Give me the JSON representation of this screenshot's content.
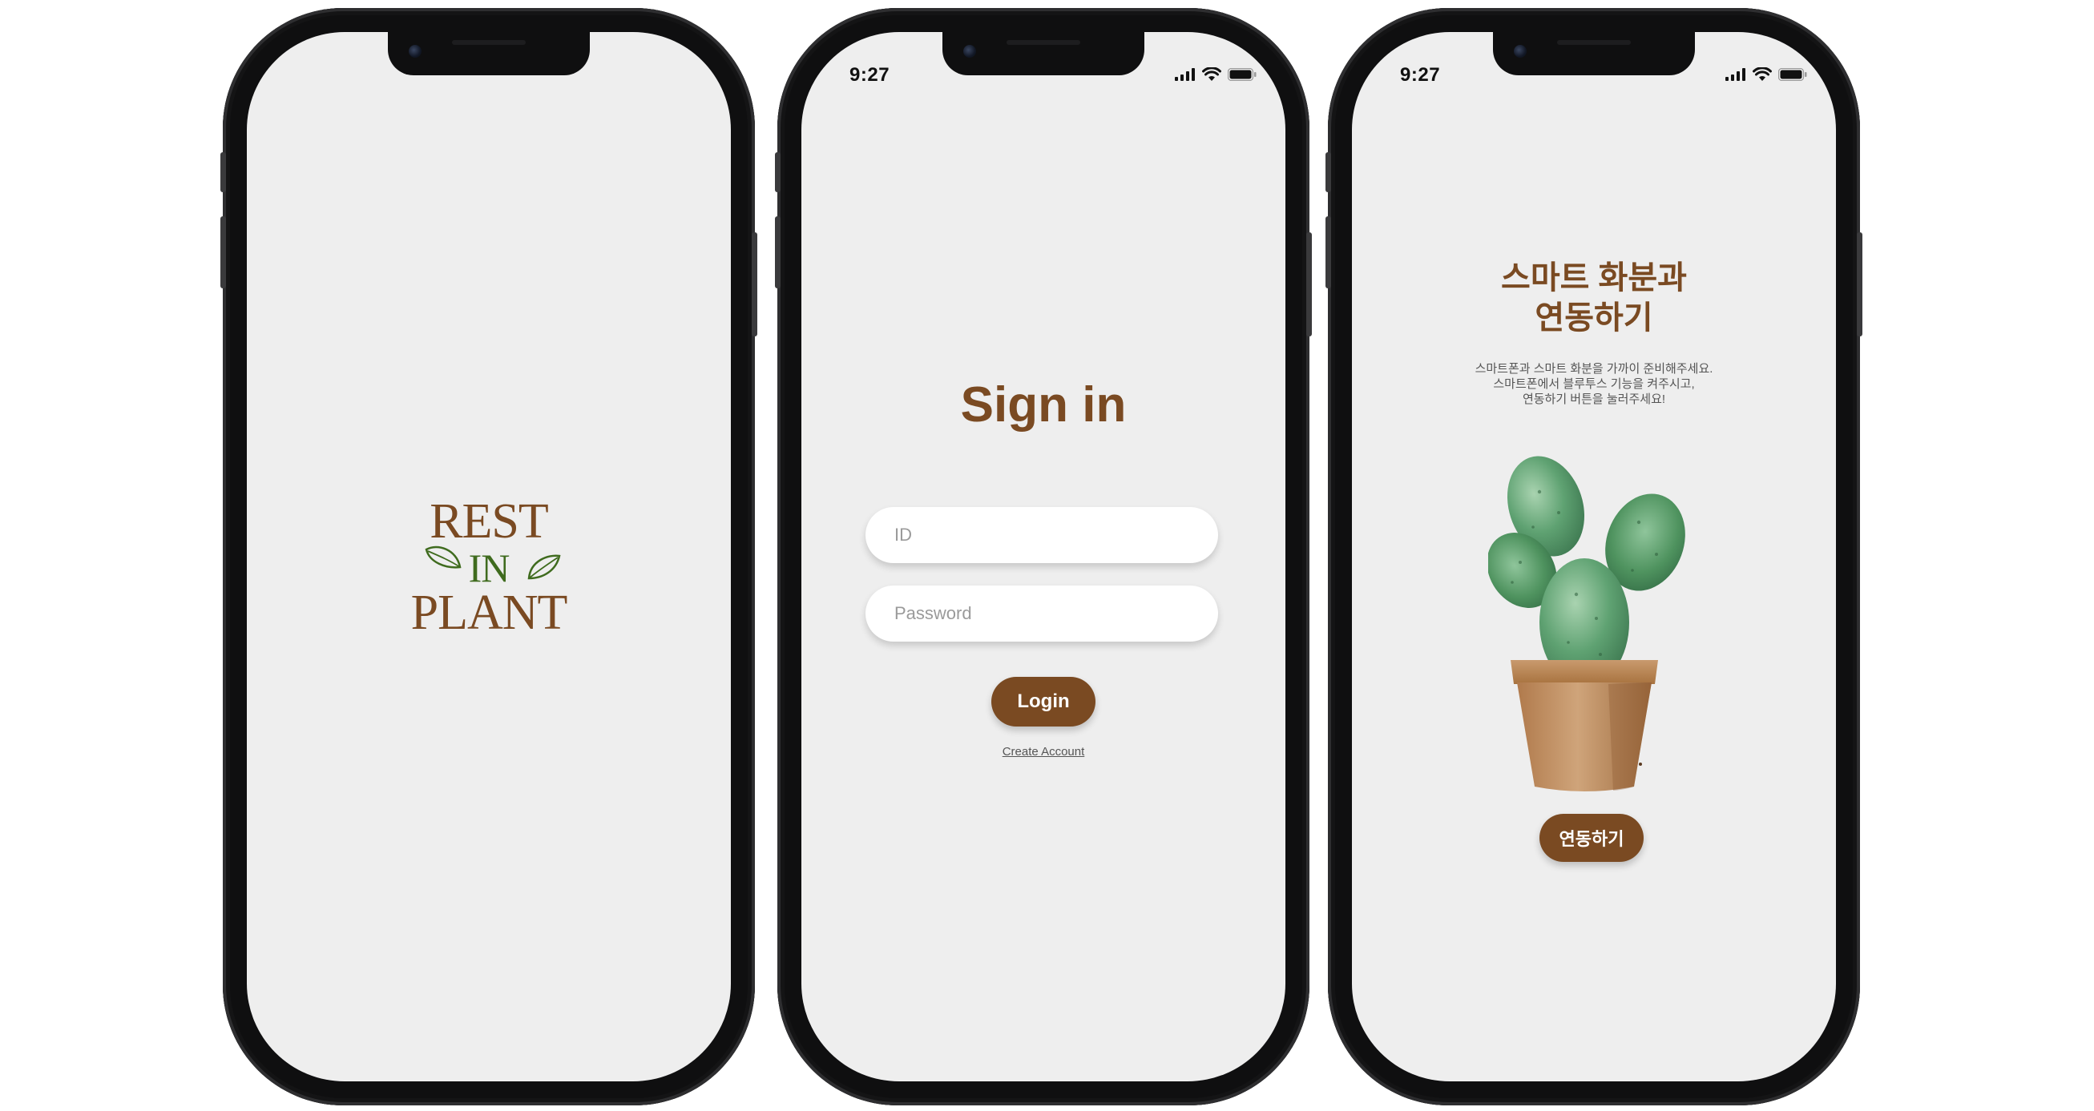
{
  "status_bar": {
    "time": "9:27"
  },
  "splash": {
    "logo_rest": "REST",
    "logo_in": "IN",
    "logo_plant": "PLANT"
  },
  "signin": {
    "title": "Sign in",
    "id_placeholder": "ID",
    "password_placeholder": "Password",
    "login_label": "Login",
    "create_account_label": "Create Account"
  },
  "connect": {
    "title_line1": "스마트 화분과",
    "title_line2": "연동하기",
    "desc_line1": "스마트폰과 스마트 화분을 가까이 준비해주세요.",
    "desc_line2": "스마트폰에서 블루투스 기능을 켜주시고,",
    "desc_line3": "연동하기 버튼을 눌러주세요!",
    "button_label": "연동하기"
  },
  "icons": {
    "signal": "signal-icon",
    "wifi": "wifi-icon",
    "battery": "battery-icon",
    "cactus": "cactus-pot-illustration"
  },
  "colors": {
    "brand_brown": "#7a4a22",
    "brand_green": "#3f6b1e",
    "screen_bg": "#eeeeee",
    "frame": "#0f0f10"
  }
}
